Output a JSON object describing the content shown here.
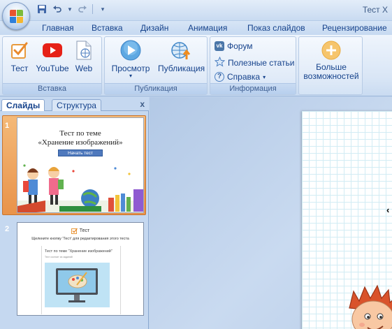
{
  "window": {
    "title": "Тест Х"
  },
  "ribbon_tabs": [
    "Главная",
    "Вставка",
    "Дизайн",
    "Анимация",
    "Показ слайдов",
    "Рецензирование"
  ],
  "groups": {
    "insert": {
      "label": "Вставка",
      "buttons": [
        "Тест",
        "YouTube",
        "Web"
      ]
    },
    "publish": {
      "label": "Публикация",
      "buttons": [
        "Просмотр",
        "Публикация"
      ]
    },
    "info": {
      "label": "Информация",
      "items": [
        "Форум",
        "Полезные статьи",
        "Справка"
      ]
    },
    "more": {
      "label_line1": "Больше",
      "label_line2": "возможностей"
    }
  },
  "panel": {
    "tabs": [
      "Слайды",
      "Структура"
    ],
    "close": "x",
    "slides": [
      {
        "number": "1",
        "title_line1": "Тест по теме",
        "title_line2": "«Хранение изображений»",
        "button": "Начать тест"
      },
      {
        "number": "2",
        "test_label": "Тест",
        "hint": "Щелкните кнопку 'Тест' для редактирования этого теста",
        "inner_title": "Тест по теме \"Хранение изображений\"",
        "inner_sub": "Тест состоит из заданий"
      }
    ]
  },
  "colors": {
    "accent": "#15428b",
    "youtube": "#e62117",
    "vk": "#4a76a8",
    "selection": "#f0a35a"
  }
}
